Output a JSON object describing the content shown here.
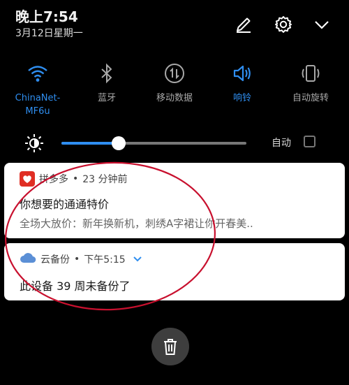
{
  "status": {
    "time": "晚上7:54",
    "date": "3月12日星期一"
  },
  "header_icons": [
    "edit-icon",
    "settings-icon",
    "collapse-chevron-icon"
  ],
  "quick_settings": [
    {
      "label": "ChinaNet-\nMF6u",
      "icon": "wifi-icon",
      "active": true
    },
    {
      "label": "蓝牙",
      "icon": "bluetooth-icon",
      "active": false
    },
    {
      "label": "移动数据",
      "icon": "mobile-data-icon",
      "active": false
    },
    {
      "label": "响铃",
      "icon": "ringer-icon",
      "active": true
    },
    {
      "label": "自动旋转",
      "icon": "auto-rotate-icon",
      "active": false
    }
  ],
  "brightness": {
    "level": 0.31,
    "auto_label": "自动",
    "auto_checked": false
  },
  "notifications": [
    {
      "app": "拼多多",
      "separator": "•",
      "time": "23 分钟前",
      "title": "你想要的通通特价",
      "body": "全场大放价：新年换新机，刺绣A字裙让你开春美.."
    },
    {
      "app": "云备份",
      "separator": "•",
      "time": "下午5:15",
      "title": "此设备 39 周未备份了"
    }
  ],
  "colors": {
    "accent": "#2f8ef0",
    "annotation": "#c8102e",
    "inactive": "#a8a8a8"
  }
}
